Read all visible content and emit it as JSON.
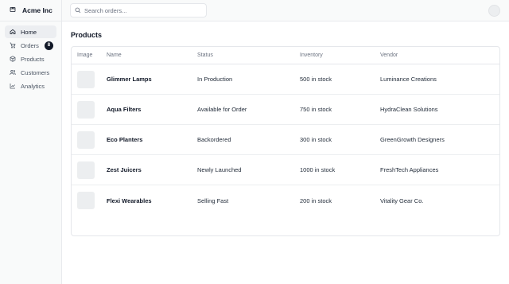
{
  "brand": {
    "name": "Acme Inc",
    "icon": "package-icon"
  },
  "nav": {
    "items": [
      {
        "label": "Home",
        "icon": "home-icon",
        "active": true
      },
      {
        "label": "Orders",
        "icon": "cart-icon",
        "badge": "8"
      },
      {
        "label": "Products",
        "icon": "box-icon"
      },
      {
        "label": "Customers",
        "icon": "users-icon"
      },
      {
        "label": "Analytics",
        "icon": "line-chart-icon"
      }
    ]
  },
  "search": {
    "placeholder": "Search orders...",
    "value": ""
  },
  "main": {
    "title": "Products"
  },
  "table": {
    "columns": [
      "Image",
      "Name",
      "Status",
      "Inventory",
      "Vendor"
    ],
    "rows": [
      {
        "name": "Glimmer Lamps",
        "status": "In Production",
        "inventory": "500 in stock",
        "vendor": "Luminance Creations"
      },
      {
        "name": "Aqua Filters",
        "status": "Available for Order",
        "inventory": "750 in stock",
        "vendor": "HydraClean Solutions"
      },
      {
        "name": "Eco Planters",
        "status": "Backordered",
        "inventory": "300 in stock",
        "vendor": "GreenGrowth Designers"
      },
      {
        "name": "Zest Juicers",
        "status": "Newly Launched",
        "inventory": "1000 in stock",
        "vendor": "FreshTech Appliances"
      },
      {
        "name": "Flexi Wearables",
        "status": "Selling Fast",
        "inventory": "200 in stock",
        "vendor": "Vitality Gear Co."
      }
    ]
  },
  "colors": {
    "sidebar_bg": "#f9fafa",
    "active_nav_bg": "#eceef1",
    "badge_bg": "#111827",
    "border": "#e5e7eb"
  }
}
